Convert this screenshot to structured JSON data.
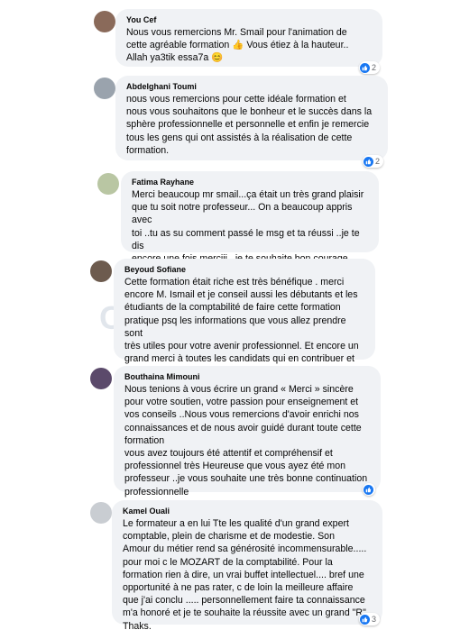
{
  "comments": [
    {
      "author": "You Cef",
      "text": "Nous vous remercions Mr. Smail pour l'animation de\ncette agréable formation 👍 Vous étiez à la hauteur..\nAllah ya3tik essa7a 😊",
      "reactions": "2",
      "avatar_color": "#8a6a5a"
    },
    {
      "author": "Abdelghani Toumi",
      "text": "nous vous remercions pour cette idéale formation et\nnous vous souhaitons que le bonheur et le succès dans la\nsphère professionnelle et personnelle et enfin je remercie\ntous les gens qui ont assistés à la réalisation de cette\nformation.",
      "reactions": "2",
      "avatar_color": "#9aa3ad"
    },
    {
      "author": "Fatima Rayhane",
      "text": "Merci beaucoup mr smail...ça était un très grand plaisir\nque tu soit notre professeur... On a beaucoup appris avec\ntoi ..tu as su comment passé le msg et ta réussi ..je te dis\nencore une fois merciii ..je te souhaite bon courage\n......*allaahh yaaatikkk esaaahaaaaaa*.",
      "reactions": "",
      "avatar_color": "#b9c6a3"
    },
    {
      "author": "Beyoud Sofiane",
      "text": "Cette formation était riche est très bénéfique . merci\nencore M. Ismail et je conseil aussi les débutants et les\nétudiants de la comptabilité de faire cette formation\npratique psq les informations que vous allez prendre sont\ntrès utiles pour votre avenir professionnel. Et encore un\ngrand merci à toutes les candidats qui en contribuer et\nqui en enrichi cette formation.",
      "reactions": "",
      "avatar_color": "#6d5b4e"
    },
    {
      "author": "Bouthaina Mimouni",
      "text": "Nous tenions à vous écrire un grand « Merci » sincère\npour votre soutien, votre passion pour enseignement et\nvos conseils ..Nous vous remercions d'avoir enrichi nos\nconnaissances et de nous avoir guidé durant toute cette\nformation\nvous avez toujours été attentif et compréhensif et\nprofessionnel très Heureuse que vous ayez été mon\nprofesseur ..je vous souhaite une très bonne continuation\nprofessionnelle",
      "reactions": "",
      "avatar_color": "#5b4a6b"
    },
    {
      "author": "Kamel Ouali",
      "text": "Le formateur a en lui Tte les qualité d'un grand expert\ncomptable, plein de charisme et de modestie. Son\nAmour du métier rend sa générosité incommensurable.....\npour moi c le MOZART de la comptabilité. Pour la\nformation rien à dire, un vrai buffet intellectuel.... bref une\nopportunité à ne pas rater, c de loin la meilleure affaire\nque j'ai conclu ..... personnellement faire ta connaissance\nm'a honoré et je te souhaite la réussite avec un grand \"R\"\nThaks.",
      "reactions": "3",
      "avatar_color": "#c9cdd2"
    }
  ],
  "accent_color": "#1877f2"
}
